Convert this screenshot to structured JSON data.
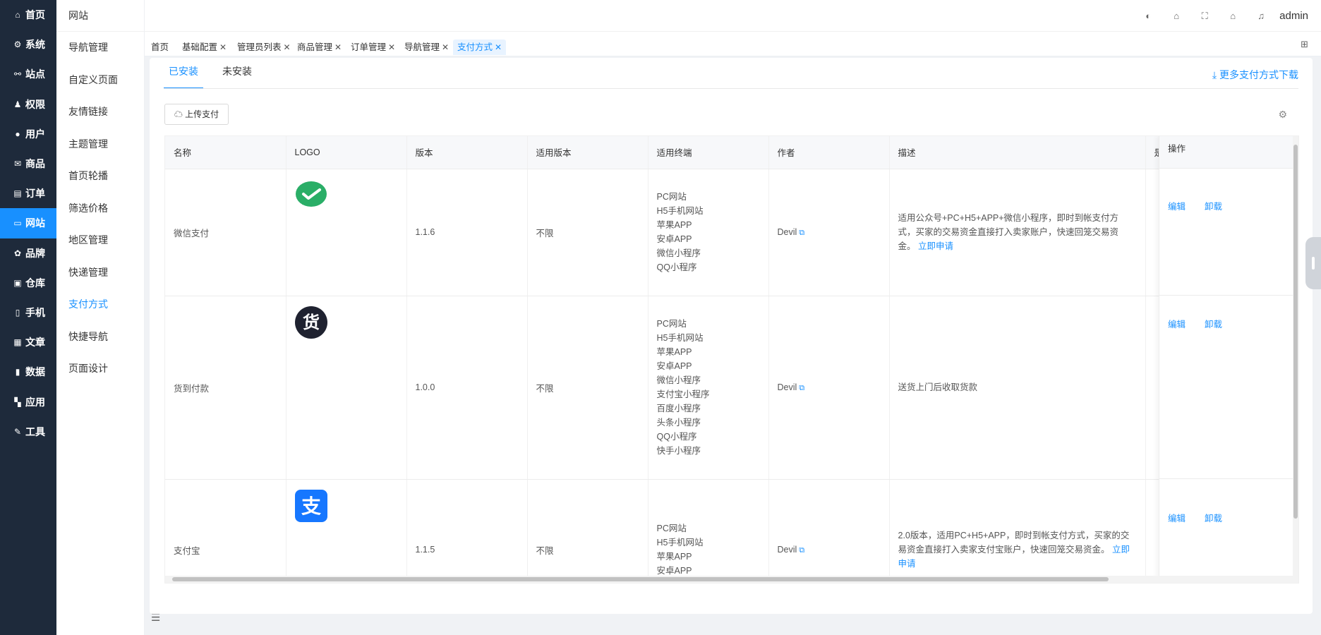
{
  "sidebar": {
    "items": [
      {
        "icon": "home-icon",
        "glyph": "⌂",
        "label": "首页"
      },
      {
        "icon": "gear-icon",
        "glyph": "⚙",
        "label": "系统"
      },
      {
        "icon": "site-icon",
        "glyph": "⚯",
        "label": "站点"
      },
      {
        "icon": "user-lock-icon",
        "glyph": "♟",
        "label": "权限"
      },
      {
        "icon": "user-icon",
        "glyph": "●",
        "label": "用户"
      },
      {
        "icon": "goods-icon",
        "glyph": "✉",
        "label": "商品"
      },
      {
        "icon": "order-icon",
        "glyph": "▤",
        "label": "订单"
      },
      {
        "icon": "website-icon",
        "glyph": "▭",
        "label": "网站"
      },
      {
        "icon": "brand-icon",
        "glyph": "✿",
        "label": "品牌"
      },
      {
        "icon": "warehouse-icon",
        "glyph": "▣",
        "label": "仓库"
      },
      {
        "icon": "mobile-icon",
        "glyph": "▯",
        "label": "手机"
      },
      {
        "icon": "article-icon",
        "glyph": "▦",
        "label": "文章"
      },
      {
        "icon": "chart-icon",
        "glyph": "▮",
        "label": "数据"
      },
      {
        "icon": "apps-icon",
        "glyph": "▚",
        "label": "应用"
      },
      {
        "icon": "wrench-icon",
        "glyph": "✎",
        "label": "工具"
      }
    ],
    "active_index": 7
  },
  "subnav": {
    "title": "网站",
    "items": [
      "导航管理",
      "自定义页面",
      "友情链接",
      "主题管理",
      "首页轮播",
      "筛选价格",
      "地区管理",
      "快递管理",
      "支付方式",
      "快捷导航",
      "页面设计"
    ],
    "active_index": 8
  },
  "topbar": {
    "user": "admin",
    "icons": [
      "palette-icon",
      "bank-icon",
      "fullscreen-icon",
      "home-icon",
      "bell-icon"
    ]
  },
  "tabs": [
    {
      "label": "首页",
      "closable": false
    },
    {
      "label": "基础配置",
      "closable": true
    },
    {
      "label": "管理员列表",
      "closable": true
    },
    {
      "label": "商品管理",
      "closable": true
    },
    {
      "label": "订单管理",
      "closable": true
    },
    {
      "label": "导航管理",
      "closable": true
    },
    {
      "label": "支付方式",
      "closable": true,
      "active": true
    }
  ],
  "content": {
    "tab_installed": "已安装",
    "tab_uninstalled": "未安装",
    "more_link": "更多支付方式下载",
    "upload_button": "上传支付"
  },
  "table": {
    "headers": [
      "名称",
      "LOGO",
      "版本",
      "适用版本",
      "适用终端",
      "作者",
      "描述",
      "是否启",
      "操作"
    ],
    "rows": [
      {
        "name": "微信支付",
        "logo": "wechat",
        "version": "1.1.6",
        "applicable": "不限",
        "terminals": [
          "PC网站",
          "H5手机网站",
          "苹果APP",
          "安卓APP",
          "微信小程序",
          "QQ小程序"
        ],
        "author": "Devil",
        "desc": "适用公众号+PC+H5+APP+微信小程序，即时到帐支付方式，买家的交易资金直接打入卖家账户，快速回笼交易资金。",
        "apply": "立即申请"
      },
      {
        "name": "货到付款",
        "logo": "cod",
        "version": "1.0.0",
        "applicable": "不限",
        "terminals": [
          "PC网站",
          "H5手机网站",
          "苹果APP",
          "安卓APP",
          "微信小程序",
          "支付宝小程序",
          "百度小程序",
          "头条小程序",
          "QQ小程序",
          "快手小程序"
        ],
        "author": "Devil",
        "desc": "送货上门后收取货款",
        "apply": ""
      },
      {
        "name": "支付宝",
        "logo": "alipay",
        "version": "1.1.5",
        "applicable": "不限",
        "terminals": [
          "PC网站",
          "H5手机网站",
          "苹果APP",
          "安卓APP"
        ],
        "author": "Devil",
        "desc": "2.0版本，适用PC+H5+APP，即时到帐支付方式，买家的交易资金直接打入卖家支付宝账户，快速回笼交易资金。",
        "apply": "立即申请"
      }
    ],
    "ops": {
      "edit": "编辑",
      "uninstall": "卸载"
    },
    "logo_text": {
      "cod": "货",
      "alipay": "支"
    }
  },
  "colors": {
    "primary": "#1890ff",
    "sidebar_bg": "#1e2a3b",
    "wechat": "#2aae67",
    "alipay": "#1677ff",
    "cod": "#1f2230"
  }
}
